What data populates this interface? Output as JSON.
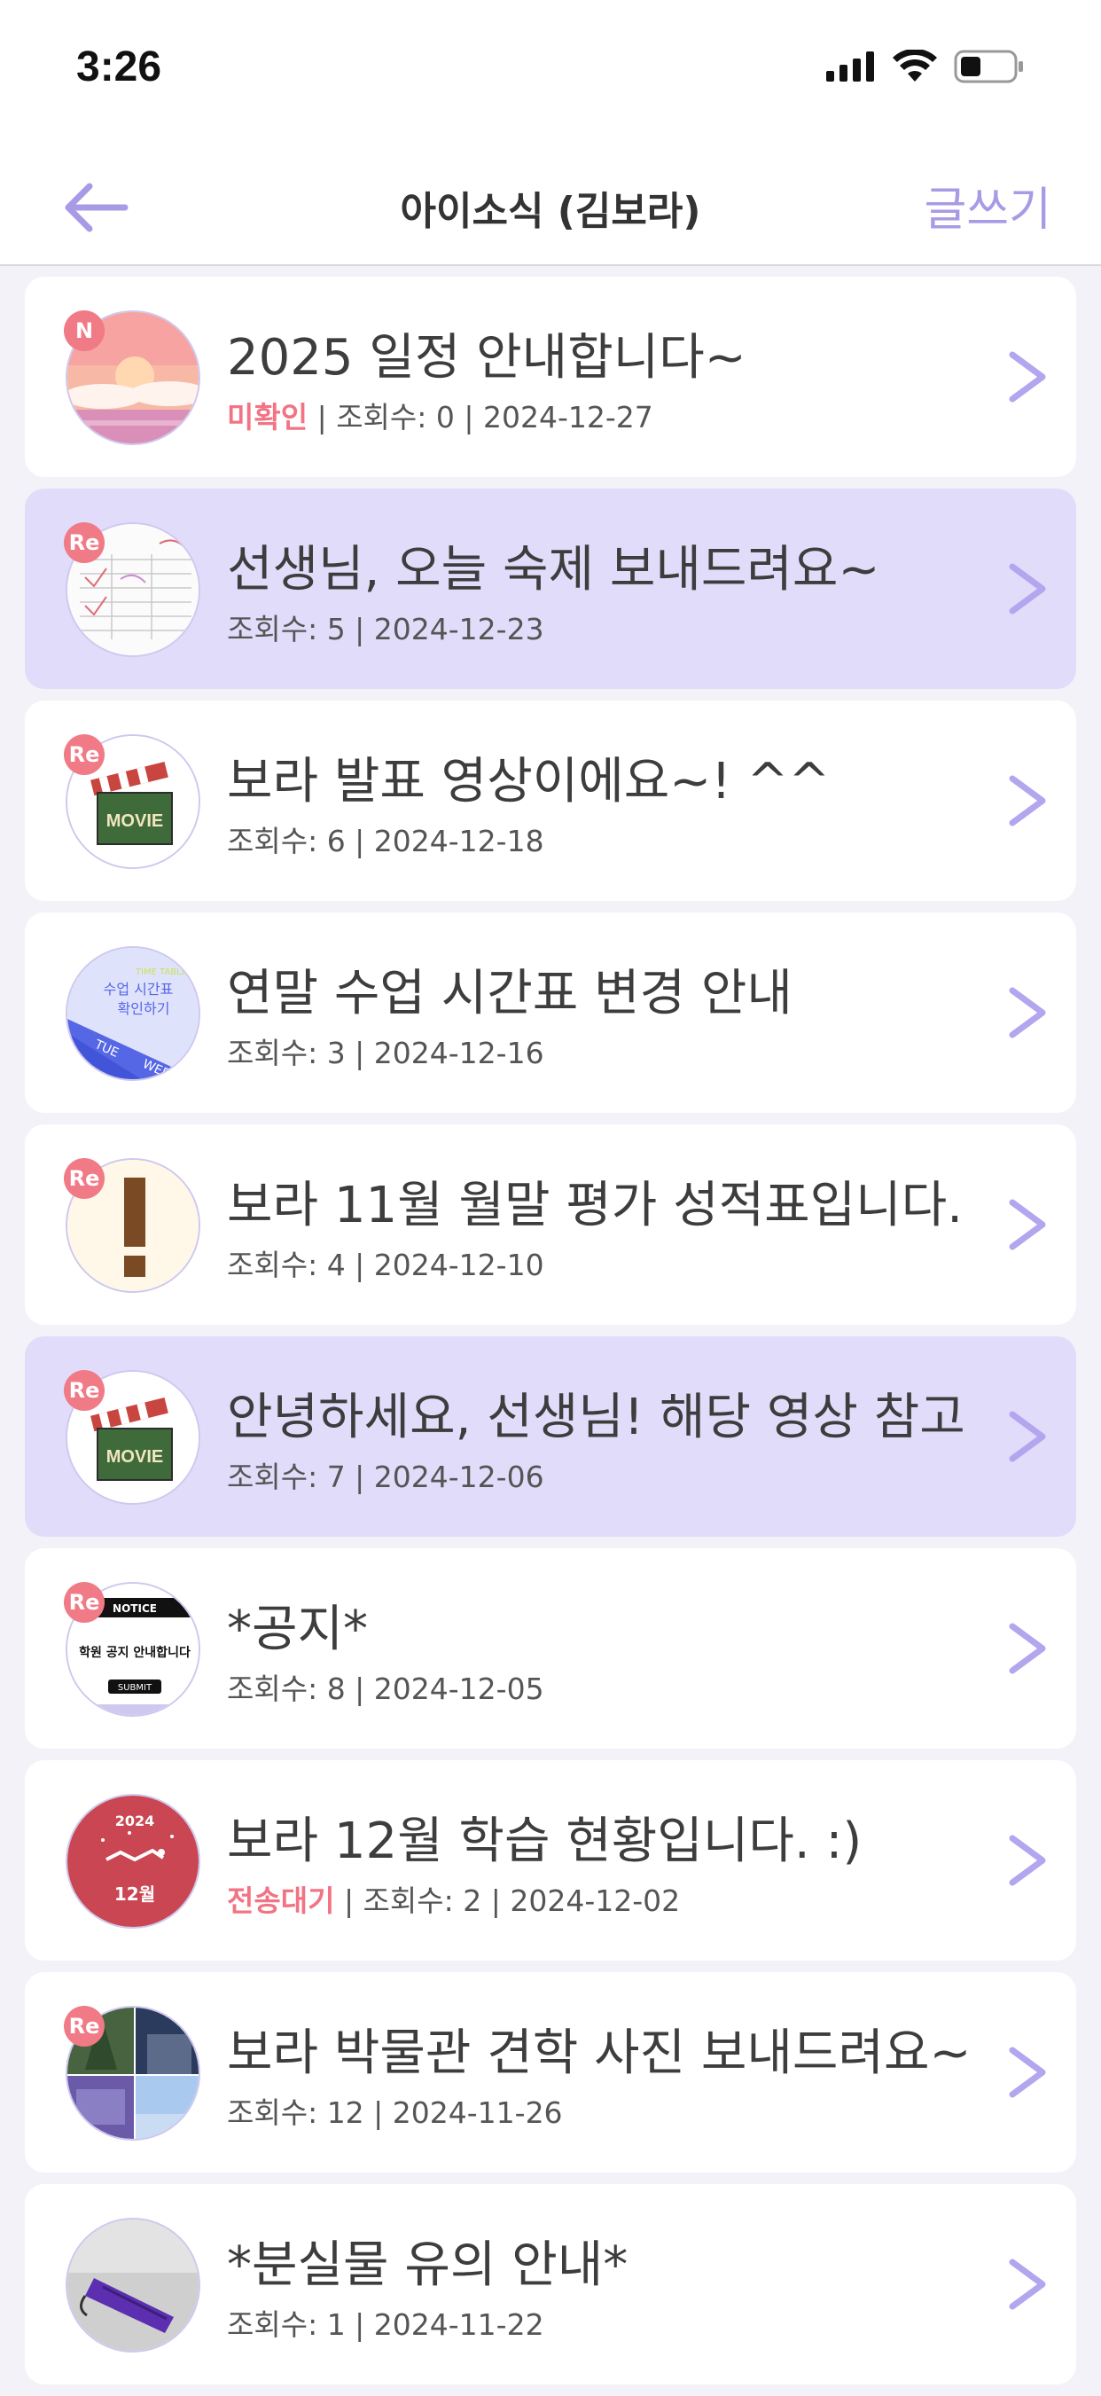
{
  "status_bar": {
    "time": "3:26"
  },
  "nav": {
    "title": "아이소식 (김보라)",
    "write_label": "글쓰기"
  },
  "colors": {
    "accent": "#a99ae6",
    "highlight": "#e2dcfb",
    "badge": "#f07a86",
    "status_text": "#f27484"
  },
  "posts": [
    {
      "badge": "N",
      "title": "2025 일정 안내합니다~",
      "status": "미확인",
      "meta": " | 조회수: 0 | 2024-12-27",
      "highlighted": false,
      "thumb": "sunset-image"
    },
    {
      "badge": "Re",
      "title": "선생님, 오늘 숙제 보내드려요~",
      "status": "",
      "meta": "조회수: 5 | 2024-12-23",
      "highlighted": true,
      "thumb": "homework-sheet-image"
    },
    {
      "badge": "Re",
      "title": "보라 발표 영상이에요~! ^^",
      "status": "",
      "meta": "조회수: 6 | 2024-12-18",
      "highlighted": false,
      "thumb": "movie-clapper-image"
    },
    {
      "badge": "",
      "title": "연말 수업 시간표 변경 안내",
      "status": "",
      "meta": "조회수: 3 | 2024-12-16",
      "highlighted": false,
      "thumb": "timetable-image"
    },
    {
      "badge": "Re",
      "title": "보라 11월 월말 평가 성적표입니다.",
      "status": "",
      "meta": "조회수: 4 | 2024-12-10",
      "highlighted": false,
      "thumb": "exclamation-image"
    },
    {
      "badge": "Re",
      "title": "안녕하세요, 선생님! 해당 영상 참고",
      "status": "",
      "meta": "조회수: 7 | 2024-12-06",
      "highlighted": true,
      "thumb": "movie-clapper-image"
    },
    {
      "badge": "Re",
      "title": "*공지*",
      "status": "",
      "meta": "조회수: 8 | 2024-12-05",
      "highlighted": false,
      "thumb": "notice-image"
    },
    {
      "badge": "",
      "title": "보라 12월 학습 현황입니다. :)",
      "status": "전송대기",
      "meta": " | 조회수: 2 | 2024-12-02",
      "highlighted": false,
      "thumb": "christmas-image"
    },
    {
      "badge": "Re",
      "title": "보라 박물관 견학 사진 보내드려요~",
      "status": "",
      "meta": "조회수: 12 | 2024-11-26",
      "highlighted": false,
      "thumb": "museum-photos-image"
    },
    {
      "badge": "",
      "title": "*분실물 유의 안내*",
      "status": "",
      "meta": "조회수: 1 | 2024-11-22",
      "highlighted": false,
      "thumb": "umbrella-image"
    }
  ],
  "thumb_text": {
    "timetable": {
      "line1": "수업 시간표",
      "line2": "확인하기",
      "tag": "TIME TABLE",
      "day1": "TUE",
      "day2": "WED"
    },
    "clapper": "MOVIE",
    "notice": {
      "top": "NOTICE",
      "middle": "학원 공지 안내합니다",
      "bottom": "SUBMIT"
    },
    "christmas": {
      "year": "2024",
      "month": "12월"
    }
  }
}
